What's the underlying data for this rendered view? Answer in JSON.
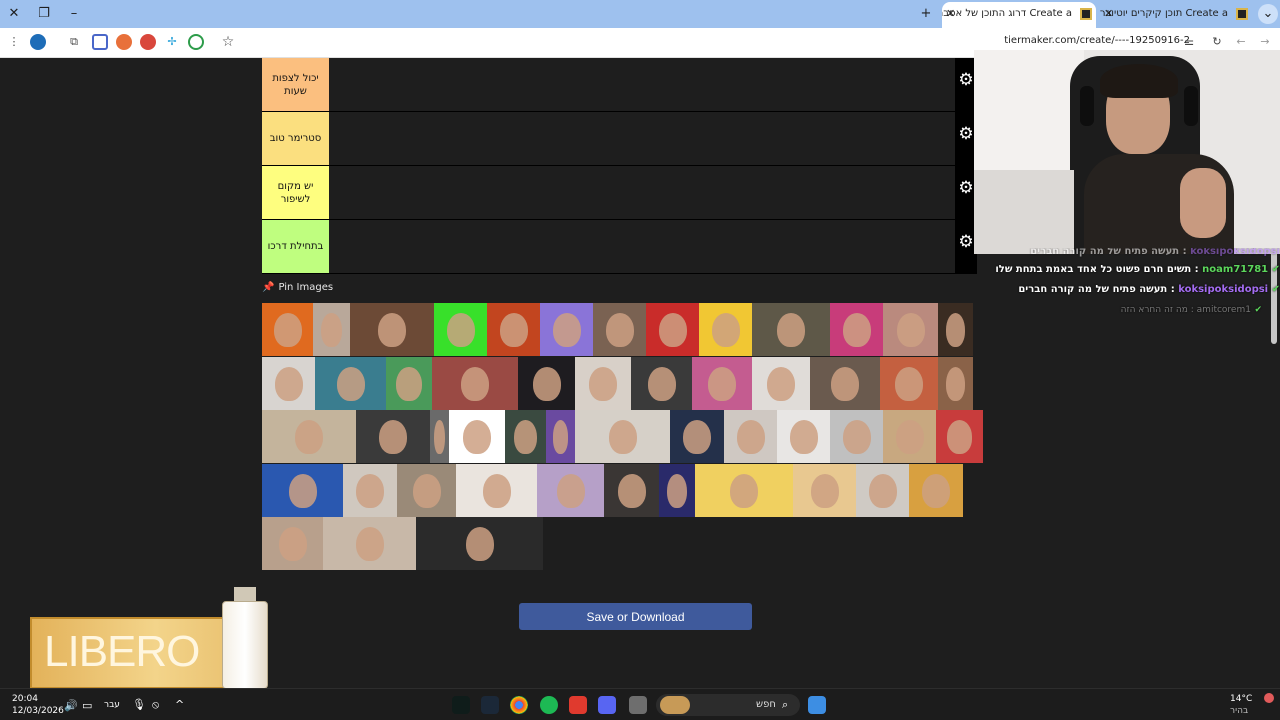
{
  "browser": {
    "tabs": [
      {
        "label": "Create a תוכן קיקרים יוטיוברים"
      },
      {
        "label": "Create a דרוג התוכן של אסברלנד"
      }
    ],
    "url": "tiermaker.com/create/----19250916-2"
  },
  "tiers": [
    {
      "label": "יכול לצפות שעות",
      "color": "#fbbf7f"
    },
    {
      "label": "סטרימר טוב",
      "color": "#fbdf7f"
    },
    {
      "label": "יש מקום לשיפור",
      "color": "#fefe7f"
    },
    {
      "label": "בתחילת דרכו",
      "color": "#bffe7f"
    }
  ],
  "pin_images": {
    "label": "Pin Images"
  },
  "save_button": {
    "label": "Save or Download"
  },
  "chat": [
    {
      "user": "koksipoksidopsi",
      "message": "תעשה פתיח של מה קורה חברים"
    },
    {
      "user": "noam71781",
      "message": "תשים חרם פשוט כל אחד באמת בתחת שלו"
    },
    {
      "user": "koksipoksidopsi",
      "message": "תעשה פתיח של מה קורה חברים"
    },
    {
      "user": "amitcorem1",
      "message": "מה זה החרא הזה"
    }
  ],
  "promo": {
    "brand": "LIBERO"
  },
  "taskbar": {
    "time": "20:04",
    "date": "12/03/2026",
    "lang": "עבר",
    "search_placeholder": "חפש",
    "weather_temp": "14°C",
    "weather_desc": "בהיר"
  }
}
